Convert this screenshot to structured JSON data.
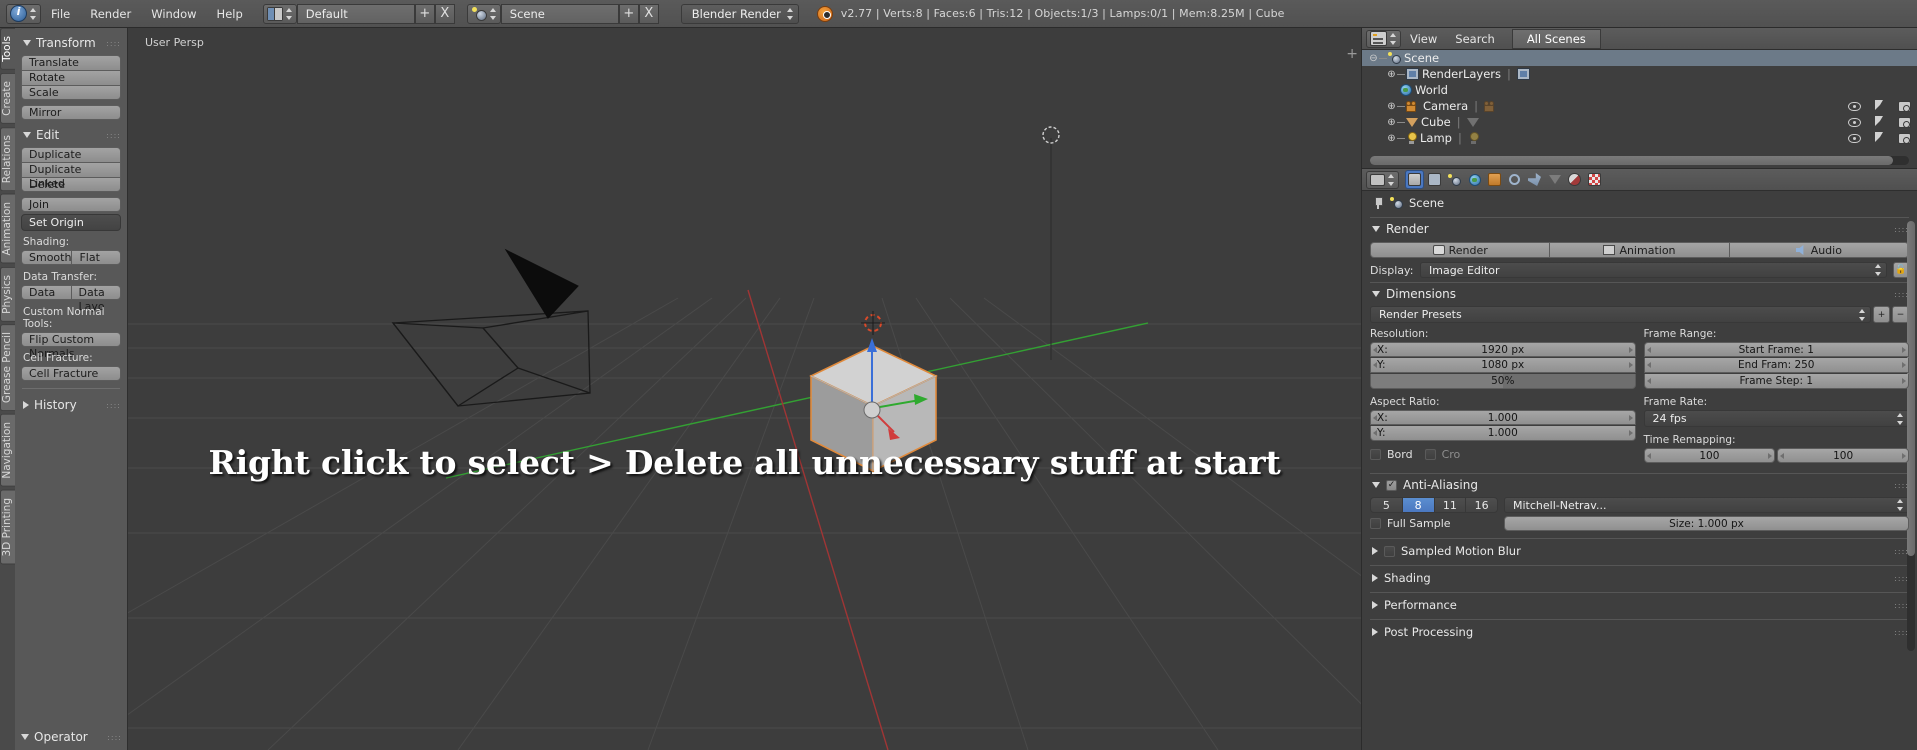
{
  "topbar": {
    "menus": [
      "File",
      "Render",
      "Window",
      "Help"
    ],
    "screen_layout": "Default",
    "scene_name": "Scene",
    "render_engine": "Blender Render",
    "stats": "v2.77 | Verts:8 | Faces:6 | Tris:12 | Objects:1/3 | Lamps:0/1 | Mem:8.25M | Cube",
    "add_label": "+",
    "remove_label": "X"
  },
  "viewport": {
    "persp_label": "User Persp",
    "overlay_text": "Right click to select > Delete all unnecessary stuff at start",
    "plus_label": "+"
  },
  "toolshelf": {
    "tabs": [
      "Tools",
      "Create",
      "Relations",
      "Animation",
      "Physics",
      "Grease Pencil",
      "Navigation",
      "3D Printing"
    ],
    "active_tab": "Tools",
    "transform": {
      "title": "Transform",
      "buttons": [
        "Translate",
        "Rotate",
        "Scale",
        "Mirror"
      ]
    },
    "edit": {
      "title": "Edit",
      "buttons": [
        "Duplicate",
        "Duplicate Linked",
        "Delete",
        "Join",
        "Set Origin"
      ],
      "shading_label": "Shading:",
      "shading_buttons": [
        "Smooth",
        "Flat"
      ],
      "data_transfer_label": "Data Transfer:",
      "data_transfer_buttons": [
        "Data",
        "Data Layo"
      ],
      "custom_normal_label": "Custom Normal Tools:",
      "custom_normal_button": "Flip Custom Normals",
      "cell_fracture_label": "Cell Fracture:",
      "cell_fracture_button": "Cell Fracture"
    },
    "history": "History",
    "operator": "Operator"
  },
  "outliner": {
    "menus": [
      "View",
      "Search"
    ],
    "display_mode": "All Scenes",
    "rows": [
      {
        "label": "Scene",
        "icon": "scene-icon",
        "selected": true,
        "expander": "-",
        "indent": 0,
        "has_toggles": false
      },
      {
        "label": "RenderLayers",
        "icon": "renderlayers-icon",
        "selected": false,
        "expander": "+",
        "indent": 1,
        "has_toggles": false
      },
      {
        "label": "World",
        "icon": "world-icon",
        "selected": false,
        "expander": "",
        "indent": 1,
        "has_toggles": false
      },
      {
        "label": "Camera",
        "icon": "camera-icon",
        "selected": false,
        "expander": "+",
        "indent": 1,
        "has_toggles": true
      },
      {
        "label": "Cube",
        "icon": "mesh-icon",
        "selected": false,
        "expander": "+",
        "indent": 1,
        "has_toggles": true
      },
      {
        "label": "Lamp",
        "icon": "lamp-icon",
        "selected": false,
        "expander": "+",
        "indent": 1,
        "has_toggles": true
      }
    ]
  },
  "properties": {
    "breadcrumb_scene": "Scene",
    "render": {
      "title": "Render",
      "buttons": [
        "Render",
        "Animation",
        "Audio"
      ],
      "display_label": "Display:",
      "display_value": "Image Editor"
    },
    "dimensions": {
      "title": "Dimensions",
      "presets": "Render Presets",
      "resolution_label": "Resolution:",
      "res_x_label": "X:",
      "res_x_value": "1920 px",
      "res_y_label": "Y:",
      "res_y_value": "1080 px",
      "res_percent": "50%",
      "frame_range_label": "Frame Range:",
      "start_frame": "Start Frame: 1",
      "end_frame": "End Fram: 250",
      "frame_step": "Frame Step:  1",
      "aspect_label": "Aspect Ratio:",
      "aspect_x_label": "X:",
      "aspect_x_value": "1.000",
      "aspect_y_label": "Y:",
      "aspect_y_value": "1.000",
      "frame_rate_label": "Frame Rate:",
      "frame_rate_value": "24 fps",
      "time_remap_label": "Time Remapping:",
      "time_remap_old": "100",
      "time_remap_new": "100",
      "border_label": "Bord",
      "crop_label": "Cro"
    },
    "antialiasing": {
      "title": "Anti-Aliasing",
      "samples": [
        "5",
        "8",
        "11",
        "16"
      ],
      "active_sample": "8",
      "filter": "Mitchell-Netrav...",
      "full_sample_label": "Full Sample",
      "size_value": "Size: 1.000 px"
    },
    "collapsed_sections": [
      "Sampled Motion Blur",
      "Shading",
      "Performance",
      "Post Processing"
    ]
  }
}
